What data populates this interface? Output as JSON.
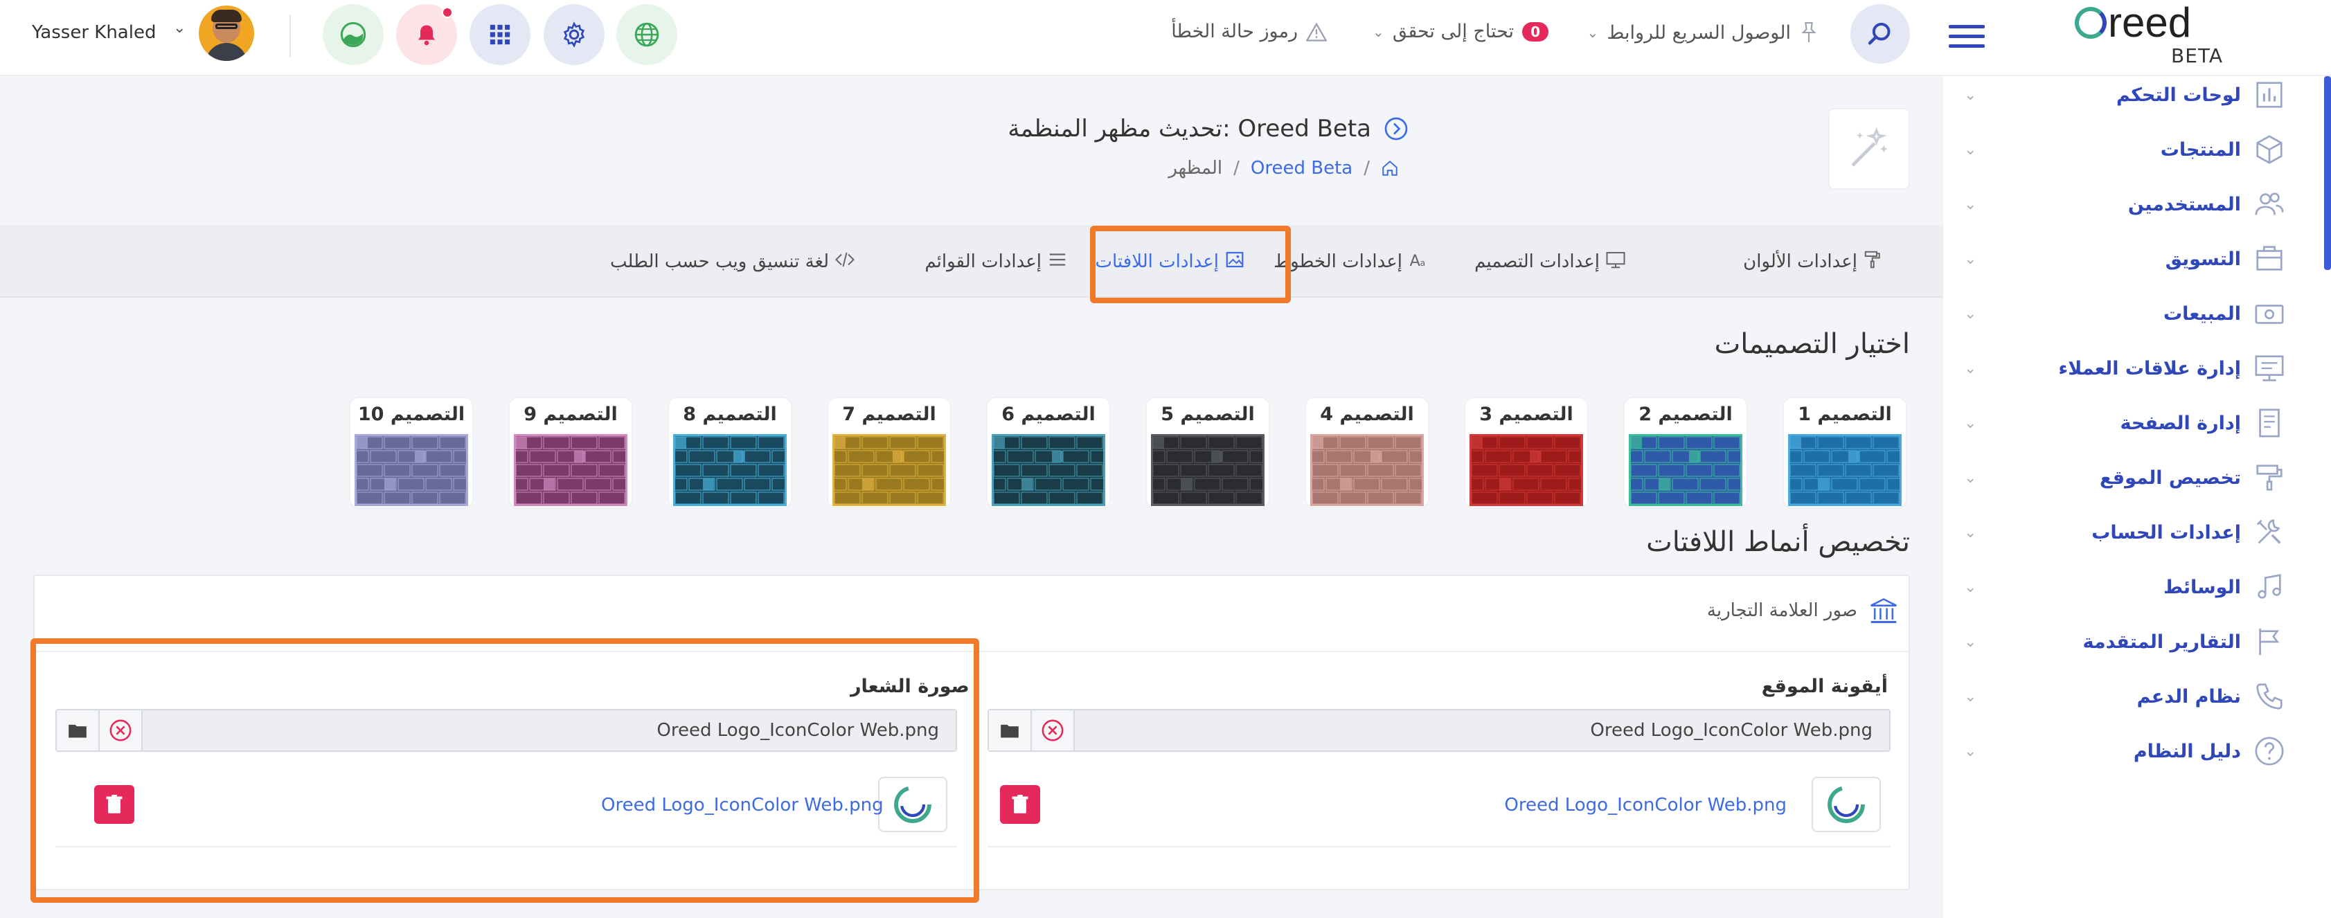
{
  "topbar": {
    "user_name": "Yasser Khaled",
    "logo_text": "reed",
    "logo_sub": "BETA",
    "error_codes": "رموز حالة الخطأ",
    "needs_check": "تحتاج إلى تحقق",
    "needs_check_count": "0",
    "quick_links": "الوصول السريع للروابط"
  },
  "sidebar": {
    "items": [
      {
        "label": "لوحات التحكم",
        "icon": "dashboard-icon"
      },
      {
        "label": "المنتجات",
        "icon": "box-icon"
      },
      {
        "label": "المستخدمين",
        "icon": "users-icon"
      },
      {
        "label": "التسويق",
        "icon": "marketing-icon"
      },
      {
        "label": "المبيعات",
        "icon": "sales-icon"
      },
      {
        "label": "إدارة علاقات العملاء",
        "icon": "crm-icon"
      },
      {
        "label": "إدارة الصفحة",
        "icon": "page-icon"
      },
      {
        "label": "تخصيص الموقع",
        "icon": "paint-roller-icon"
      },
      {
        "label": "إعدادات الحساب",
        "icon": "tools-icon"
      },
      {
        "label": "الوسائط",
        "icon": "music-icon"
      },
      {
        "label": "التقارير المتقدمة",
        "icon": "flag-icon"
      },
      {
        "label": "نظام الدعم",
        "icon": "phone-icon"
      },
      {
        "label": "دليل النظام",
        "icon": "help-icon"
      }
    ]
  },
  "page": {
    "title": "تحديث مظهر المنظمة: Oreed Beta",
    "breadcrumb_org": "Oreed Beta",
    "breadcrumb_sep": "/",
    "breadcrumb_current": "المظهر"
  },
  "tabs": [
    {
      "label": "إعدادات الألوان",
      "icon": "paint-roller-icon"
    },
    {
      "label": "إعدادات التصميم",
      "icon": "monitor-icon"
    },
    {
      "label": "إعدادات الخطوط",
      "icon": "font-icon"
    },
    {
      "label": "إعدادات اللافتات",
      "icon": "image-icon"
    },
    {
      "label": "إعدادات القوائم",
      "icon": "menu-icon"
    },
    {
      "label": "لغة تنسيق ويب حسب الطلب",
      "icon": "code-icon"
    }
  ],
  "themes_title": "اختيار التصميمات",
  "themes": [
    {
      "label": "التصميم 1",
      "color": "#1e6fa8",
      "accent": "#49a9e0"
    },
    {
      "label": "التصميم 2",
      "color": "#2f5aa8",
      "accent": "#3dbd9a"
    },
    {
      "label": "التصميم 3",
      "color": "#9e1b1b",
      "accent": "#d23a3a"
    },
    {
      "label": "التصميم 4",
      "color": "#a8766e",
      "accent": "#d8a8a0"
    },
    {
      "label": "التصميم 5",
      "color": "#2a2c30",
      "accent": "#5a5c62"
    },
    {
      "label": "التصميم 6",
      "color": "#183c48",
      "accent": "#4aa0b8"
    },
    {
      "label": "التصميم 7",
      "color": "#9a7a1e",
      "accent": "#e0b040"
    },
    {
      "label": "التصميم 8",
      "color": "#1a4a60",
      "accent": "#4ab0d8"
    },
    {
      "label": "التصميم 9",
      "color": "#7a3a6a",
      "accent": "#d08ac0"
    },
    {
      "label": "التصميم 10",
      "color": "#6a6a9a",
      "accent": "#a8a8d8"
    }
  ],
  "banner_title": "تخصيص أنماط اللافتات",
  "brand_images": "صور العلامة التجارية",
  "site_icon": {
    "label": "أيقونة الموقع",
    "file": "Oreed Logo_IconColor Web.png",
    "link": "Oreed Logo_IconColor Web.png"
  },
  "logo_image": {
    "label": "صورة الشعار",
    "file": "Oreed Logo_IconColor Web.png",
    "link": "Oreed Logo_IconColor Web.png"
  },
  "colors": {
    "accent": "#3d5bd9",
    "highlight": "#f07a2a",
    "danger": "#e5295a"
  }
}
